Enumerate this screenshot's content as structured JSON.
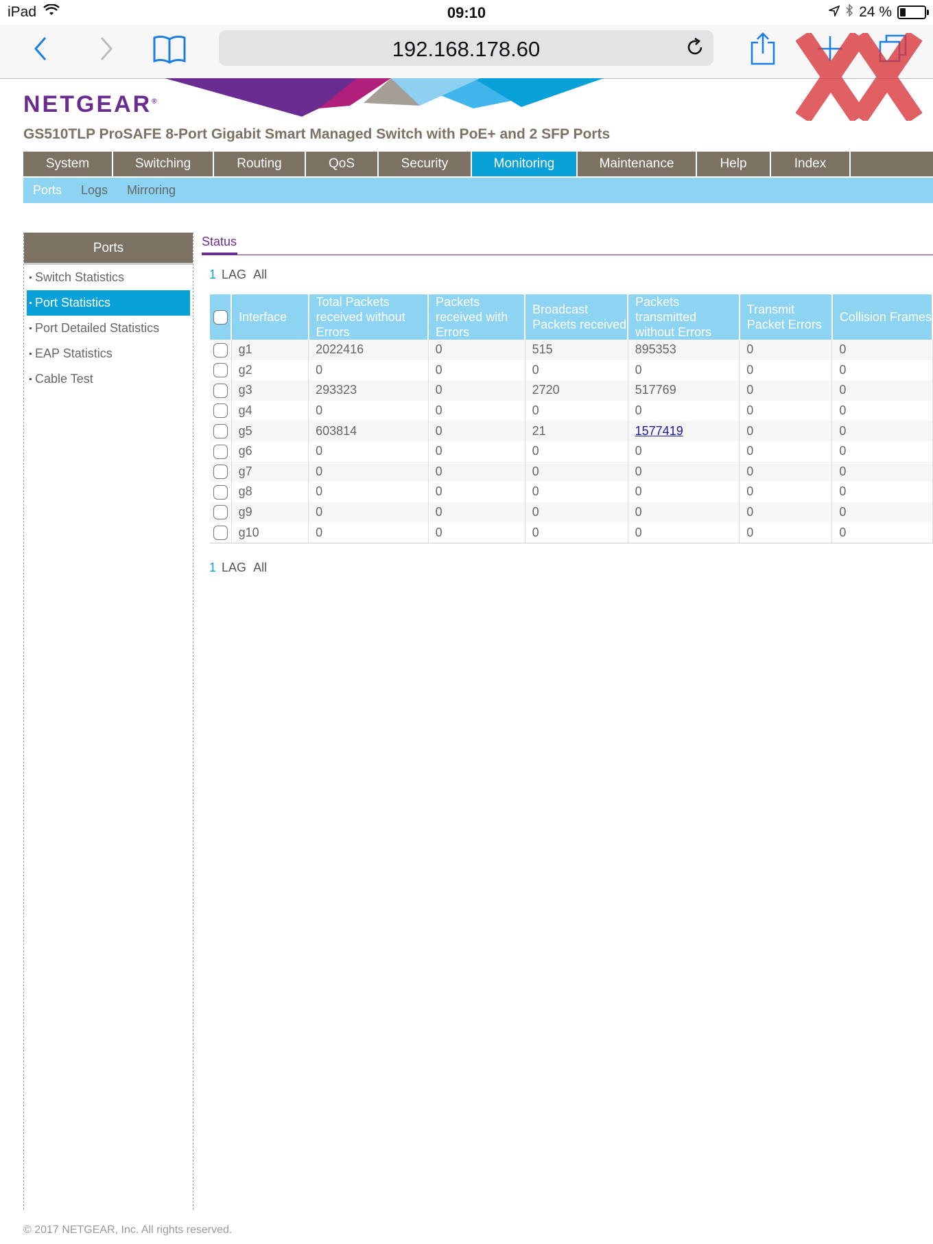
{
  "status_bar": {
    "device": "iPad",
    "time": "09:10",
    "battery": "24 %",
    "battery_level": 0.24
  },
  "browser": {
    "url": "192.168.178.60"
  },
  "header": {
    "logo": "NETGEAR",
    "logo_mark": "®",
    "product": "GS510TLP ProSAFE 8-Port Gigabit Smart Managed Switch with PoE+ and 2 SFP Ports"
  },
  "main_nav": [
    "System",
    "Switching",
    "Routing",
    "QoS",
    "Security",
    "Monitoring",
    "Maintenance",
    "Help",
    "Index"
  ],
  "sub_nav": [
    "Ports",
    "Logs",
    "Mirroring"
  ],
  "sidebar": {
    "title": "Ports",
    "items": [
      "Switch Statistics",
      "Port Statistics",
      "Port Detailed Statistics",
      "EAP Statistics",
      "Cable Test"
    ]
  },
  "content": {
    "tab": "Status",
    "lag_nav": {
      "num": "1",
      "lag": "LAG",
      "all": "All"
    },
    "columns": {
      "interface": "Interface",
      "c1": "Total Packets received without Errors",
      "c2": "Packets received with Errors",
      "c3": "Broadcast Packets received",
      "c4": "Packets transmitted without Errors",
      "c5": "Transmit Packet Errors",
      "c6": "Collision Frames"
    },
    "rows": [
      [
        "g1",
        "2022416",
        "0",
        "515",
        "895353",
        "0",
        "0"
      ],
      [
        "g2",
        "0",
        "0",
        "0",
        "0",
        "0",
        "0"
      ],
      [
        "g3",
        "293323",
        "0",
        "2720",
        "517769",
        "0",
        "0"
      ],
      [
        "g4",
        "0",
        "0",
        "0",
        "0",
        "0",
        "0"
      ],
      [
        "g5",
        "603814",
        "0",
        "21",
        "1577419",
        "0",
        "0"
      ],
      [
        "g6",
        "0",
        "0",
        "0",
        "0",
        "0",
        "0"
      ],
      [
        "g7",
        "0",
        "0",
        "0",
        "0",
        "0",
        "0"
      ],
      [
        "g8",
        "0",
        "0",
        "0",
        "0",
        "0",
        "0"
      ],
      [
        "g9",
        "0",
        "0",
        "0",
        "0",
        "0",
        "0"
      ],
      [
        "g10",
        "0",
        "0",
        "0",
        "0",
        "0",
        "0"
      ]
    ]
  },
  "footer": "© 2017 NETGEAR, Inc. All rights reserved.",
  "colors": {
    "brand": "#6b2c91",
    "accent": "#0aa0d8",
    "light_accent": "#8dd3f2",
    "nav_gray": "#7b7264"
  }
}
